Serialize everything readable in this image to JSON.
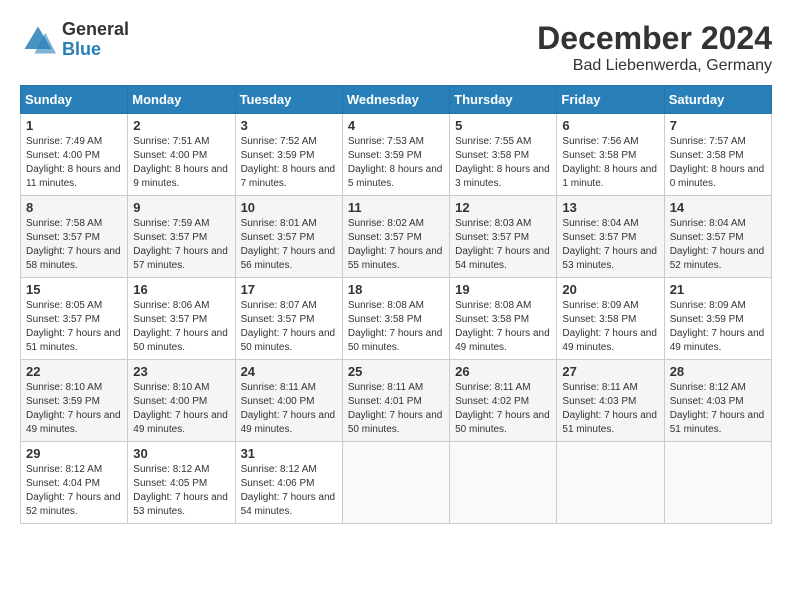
{
  "header": {
    "logo_general": "General",
    "logo_blue": "Blue",
    "title": "December 2024",
    "location": "Bad Liebenwerda, Germany"
  },
  "days_of_week": [
    "Sunday",
    "Monday",
    "Tuesday",
    "Wednesday",
    "Thursday",
    "Friday",
    "Saturday"
  ],
  "weeks": [
    [
      {
        "day": "1",
        "sunrise": "7:49 AM",
        "sunset": "4:00 PM",
        "daylight": "8 hours and 11 minutes."
      },
      {
        "day": "2",
        "sunrise": "7:51 AM",
        "sunset": "4:00 PM",
        "daylight": "8 hours and 9 minutes."
      },
      {
        "day": "3",
        "sunrise": "7:52 AM",
        "sunset": "3:59 PM",
        "daylight": "8 hours and 7 minutes."
      },
      {
        "day": "4",
        "sunrise": "7:53 AM",
        "sunset": "3:59 PM",
        "daylight": "8 hours and 5 minutes."
      },
      {
        "day": "5",
        "sunrise": "7:55 AM",
        "sunset": "3:58 PM",
        "daylight": "8 hours and 3 minutes."
      },
      {
        "day": "6",
        "sunrise": "7:56 AM",
        "sunset": "3:58 PM",
        "daylight": "8 hours and 1 minute."
      },
      {
        "day": "7",
        "sunrise": "7:57 AM",
        "sunset": "3:58 PM",
        "daylight": "8 hours and 0 minutes."
      }
    ],
    [
      {
        "day": "8",
        "sunrise": "7:58 AM",
        "sunset": "3:57 PM",
        "daylight": "7 hours and 58 minutes."
      },
      {
        "day": "9",
        "sunrise": "7:59 AM",
        "sunset": "3:57 PM",
        "daylight": "7 hours and 57 minutes."
      },
      {
        "day": "10",
        "sunrise": "8:01 AM",
        "sunset": "3:57 PM",
        "daylight": "7 hours and 56 minutes."
      },
      {
        "day": "11",
        "sunrise": "8:02 AM",
        "sunset": "3:57 PM",
        "daylight": "7 hours and 55 minutes."
      },
      {
        "day": "12",
        "sunrise": "8:03 AM",
        "sunset": "3:57 PM",
        "daylight": "7 hours and 54 minutes."
      },
      {
        "day": "13",
        "sunrise": "8:04 AM",
        "sunset": "3:57 PM",
        "daylight": "7 hours and 53 minutes."
      },
      {
        "day": "14",
        "sunrise": "8:04 AM",
        "sunset": "3:57 PM",
        "daylight": "7 hours and 52 minutes."
      }
    ],
    [
      {
        "day": "15",
        "sunrise": "8:05 AM",
        "sunset": "3:57 PM",
        "daylight": "7 hours and 51 minutes."
      },
      {
        "day": "16",
        "sunrise": "8:06 AM",
        "sunset": "3:57 PM",
        "daylight": "7 hours and 50 minutes."
      },
      {
        "day": "17",
        "sunrise": "8:07 AM",
        "sunset": "3:57 PM",
        "daylight": "7 hours and 50 minutes."
      },
      {
        "day": "18",
        "sunrise": "8:08 AM",
        "sunset": "3:58 PM",
        "daylight": "7 hours and 50 minutes."
      },
      {
        "day": "19",
        "sunrise": "8:08 AM",
        "sunset": "3:58 PM",
        "daylight": "7 hours and 49 minutes."
      },
      {
        "day": "20",
        "sunrise": "8:09 AM",
        "sunset": "3:58 PM",
        "daylight": "7 hours and 49 minutes."
      },
      {
        "day": "21",
        "sunrise": "8:09 AM",
        "sunset": "3:59 PM",
        "daylight": "7 hours and 49 minutes."
      }
    ],
    [
      {
        "day": "22",
        "sunrise": "8:10 AM",
        "sunset": "3:59 PM",
        "daylight": "7 hours and 49 minutes."
      },
      {
        "day": "23",
        "sunrise": "8:10 AM",
        "sunset": "4:00 PM",
        "daylight": "7 hours and 49 minutes."
      },
      {
        "day": "24",
        "sunrise": "8:11 AM",
        "sunset": "4:00 PM",
        "daylight": "7 hours and 49 minutes."
      },
      {
        "day": "25",
        "sunrise": "8:11 AM",
        "sunset": "4:01 PM",
        "daylight": "7 hours and 50 minutes."
      },
      {
        "day": "26",
        "sunrise": "8:11 AM",
        "sunset": "4:02 PM",
        "daylight": "7 hours and 50 minutes."
      },
      {
        "day": "27",
        "sunrise": "8:11 AM",
        "sunset": "4:03 PM",
        "daylight": "7 hours and 51 minutes."
      },
      {
        "day": "28",
        "sunrise": "8:12 AM",
        "sunset": "4:03 PM",
        "daylight": "7 hours and 51 minutes."
      }
    ],
    [
      {
        "day": "29",
        "sunrise": "8:12 AM",
        "sunset": "4:04 PM",
        "daylight": "7 hours and 52 minutes."
      },
      {
        "day": "30",
        "sunrise": "8:12 AM",
        "sunset": "4:05 PM",
        "daylight": "7 hours and 53 minutes."
      },
      {
        "day": "31",
        "sunrise": "8:12 AM",
        "sunset": "4:06 PM",
        "daylight": "7 hours and 54 minutes."
      },
      null,
      null,
      null,
      null
    ]
  ]
}
